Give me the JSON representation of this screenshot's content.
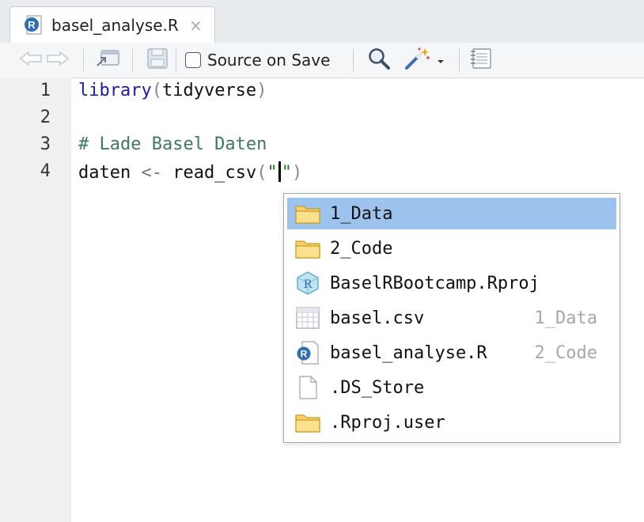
{
  "tab": {
    "title": "basel_analyse.R",
    "close": "×",
    "icon": "r-file-icon"
  },
  "toolbar": {
    "source_on_save_label": "Source on Save",
    "source_on_save_checked": false,
    "buttons": [
      "back-arrow-icon",
      "forward-arrow-icon",
      "show-in-window-icon",
      "save-icon",
      "search-icon",
      "code-tools-wand-icon",
      "chevron-down-icon",
      "compile-report-icon"
    ]
  },
  "editor": {
    "lines": [
      {
        "number": "1",
        "tokens": [
          {
            "cls": "kw",
            "text": "library"
          },
          {
            "cls": "paren",
            "text": "("
          },
          {
            "cls": "",
            "text": "tidyverse"
          },
          {
            "cls": "paren",
            "text": ")"
          }
        ]
      },
      {
        "number": "2",
        "tokens": []
      },
      {
        "number": "3",
        "tokens": [
          {
            "cls": "cm",
            "text": "# Lade Basel Daten"
          }
        ]
      },
      {
        "number": "4",
        "tokens": [
          {
            "cls": "",
            "text": "daten "
          },
          {
            "cls": "op",
            "text": "<-"
          },
          {
            "cls": "",
            "text": " read_csv"
          },
          {
            "cls": "paren",
            "text": "("
          },
          {
            "cls": "str",
            "text": "\""
          },
          {
            "cls": "cursor",
            "text": ""
          },
          {
            "cls": "str",
            "text": "\""
          },
          {
            "cls": "paren",
            "text": ")"
          }
        ]
      }
    ]
  },
  "autocomplete": {
    "items": [
      {
        "label": "1_Data",
        "hint": "",
        "icon": "folder-icon",
        "selected": true
      },
      {
        "label": "2_Code",
        "hint": "",
        "icon": "folder-icon",
        "selected": false
      },
      {
        "label": "BaselRBootcamp.Rproj",
        "hint": "",
        "icon": "rproj-icon",
        "selected": false
      },
      {
        "label": "basel.csv",
        "hint": "1_Data",
        "icon": "csv-table-icon",
        "selected": false
      },
      {
        "label": "basel_analyse.R",
        "hint": "2_Code",
        "icon": "r-file-icon",
        "selected": false
      },
      {
        "label": ".DS_Store",
        "hint": "",
        "icon": "blank-file-icon",
        "selected": false
      },
      {
        "label": ".Rproj.user",
        "hint": "",
        "icon": "folder-icon",
        "selected": false
      }
    ]
  },
  "colors": {
    "selection": "#9cc3ee",
    "keyword": "#1a1aa6",
    "comment": "#3c7a5f",
    "hint": "#a7a7a7"
  }
}
